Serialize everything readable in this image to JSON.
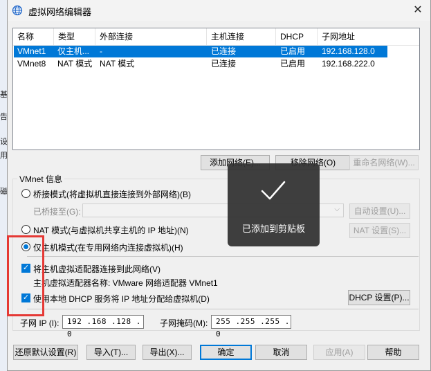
{
  "background_fragments": [
    "基",
    "告",
    "设",
    "用",
    "磁"
  ],
  "window": {
    "title": "虚拟网络编辑器",
    "close_glyph": "✕"
  },
  "network_table": {
    "columns": [
      "名称",
      "类型",
      "外部连接",
      "主机连接",
      "DHCP",
      "子网地址"
    ],
    "rows": [
      {
        "name": "VMnet1",
        "type": "仅主机...",
        "external": "-",
        "host": "已连接",
        "dhcp": "已启用",
        "subnet": "192.168.128.0",
        "selected": true
      },
      {
        "name": "VMnet8",
        "type": "NAT 模式",
        "external": "NAT 模式",
        "host": "已连接",
        "dhcp": "已启用",
        "subnet": "192.168.222.0",
        "selected": false
      }
    ]
  },
  "net_buttons": {
    "add": "添加网络(E)...",
    "remove": "移除网络(O)",
    "rename": "重命名网络(W)..."
  },
  "vmnet_info": {
    "label": "VMnet 信息",
    "bridge_mode": "桥接模式(将虚拟机直接连接到外部网络)(B)",
    "bridged_to": "已桥接至(G):",
    "auto_settings": "自动设置(U)...",
    "nat_mode": "NAT 模式(与虚拟机共享主机的 IP 地址)(N)",
    "nat_settings": "NAT 设置(S)...",
    "host_only_mode": "仅主机模式(在专用网络内连接虚拟机)(H)",
    "selected_mode": "host_only",
    "connect_adapter": "将主机虚拟适配器连接到此网络(V)",
    "adapter_name": "主机虚拟适配器名称: VMware 网络适配器 VMnet1",
    "use_dhcp": "使用本地 DHCP 服务将 IP 地址分配给虚拟机(D)",
    "dhcp_settings": "DHCP 设置(P)...",
    "subnet_ip_label": "子网 IP (I):",
    "subnet_ip": "192 .168 .128 . 0",
    "subnet_mask_label": "子网掩码(M):",
    "subnet_mask": "255 .255 .255 . 0"
  },
  "footer": {
    "restore": "还原默认设置(R)",
    "import": "导入(T)...",
    "export": "导出(X)...",
    "ok": "确定",
    "cancel": "取消",
    "apply": "应用(A)",
    "help": "帮助"
  },
  "toast": {
    "message": "已添加到剪贴板"
  },
  "colors": {
    "accent": "#0078d7",
    "highlight_box": "#e53935",
    "toast_bg": "#303030"
  }
}
